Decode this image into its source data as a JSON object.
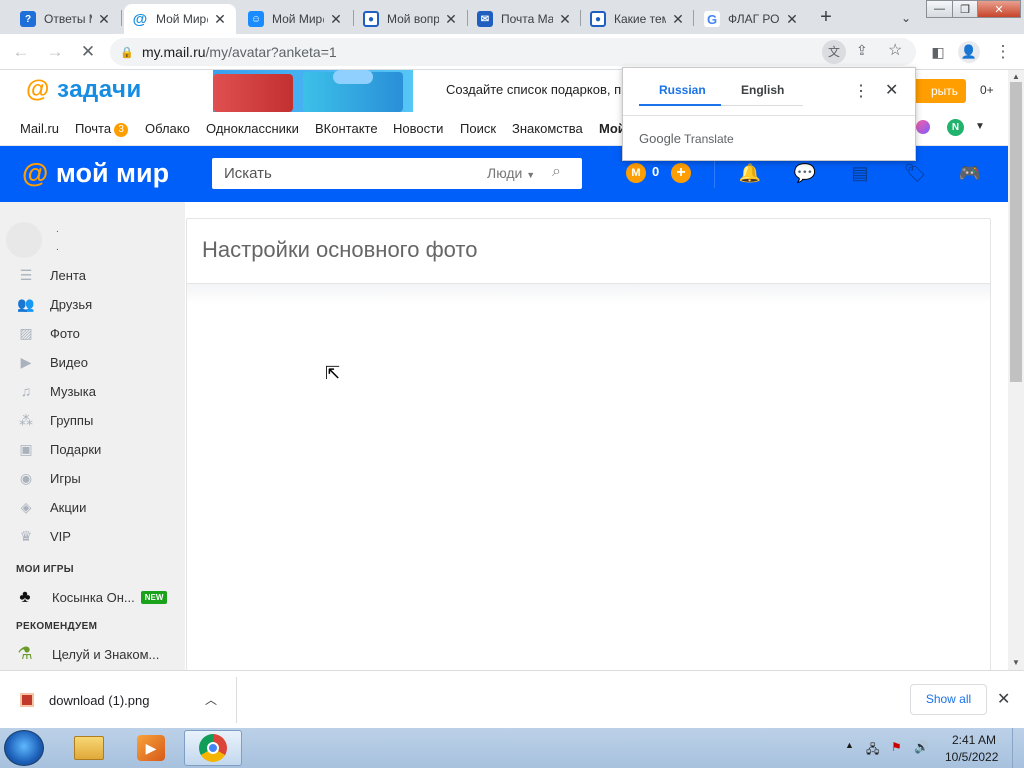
{
  "browser": {
    "tabs": [
      {
        "title": "Ответы Mail.ru",
        "favicon": "answers-icon"
      },
      {
        "title": "Мой Мир@Mail.ru",
        "favicon": "moy-mir-icon",
        "active": true
      },
      {
        "title": "Мой Мир@Mail.ru",
        "favicon": "moy-mir-face-icon"
      },
      {
        "title": "Мой вопрос",
        "favicon": "answers-icon"
      },
      {
        "title": "Почта Mail.ru",
        "favicon": "mail-icon"
      },
      {
        "title": "Какие темы",
        "favicon": "answers-icon"
      },
      {
        "title": "ФЛАГ РОССИИ",
        "favicon": "google-icon"
      }
    ],
    "new_tab": "+",
    "url_host": "my.mail.ru",
    "url_path": "/my/avatar?anketa=1"
  },
  "banner": {
    "brand": "задачи",
    "text": "Создайте список подарков, п",
    "button": "рыть",
    "age": "0+"
  },
  "portal_nav": {
    "items": [
      "Mail.ru",
      "Почта",
      "Облако",
      "Одноклассники",
      "ВКонтакте",
      "Новости",
      "Поиск",
      "Знакомства",
      "Мой"
    ],
    "mail_badge": "3",
    "avatar_letter": "N"
  },
  "header": {
    "logo": "мой мир",
    "search_placeholder": "Искать",
    "search_scope": "Люди",
    "coins": "0"
  },
  "sidebar": {
    "user_name_1": ".",
    "user_name_2": ".",
    "items": [
      {
        "label": "Лента",
        "icon": "feed-icon"
      },
      {
        "label": "Друзья",
        "icon": "friends-icon"
      },
      {
        "label": "Фото",
        "icon": "photo-icon"
      },
      {
        "label": "Видео",
        "icon": "video-icon"
      },
      {
        "label": "Музыка",
        "icon": "music-icon"
      },
      {
        "label": "Группы",
        "icon": "groups-icon"
      },
      {
        "label": "Подарки",
        "icon": "gift-icon"
      },
      {
        "label": "Игры",
        "icon": "gamepad-icon"
      },
      {
        "label": "Акции",
        "icon": "tag-icon"
      },
      {
        "label": "VIP",
        "icon": "crown-icon"
      }
    ],
    "games_heading": "МОИ ИГРЫ",
    "games": [
      {
        "label": "Косынка Он...",
        "badge": "NEW"
      }
    ],
    "recommend_heading": "РЕКОМЕНДУЕМ",
    "recommend": [
      {
        "label": "Целуй и Знаком..."
      }
    ]
  },
  "main": {
    "title": "Настройки основного фото"
  },
  "translate_popup": {
    "source_lang": "Russian",
    "target_lang": "English",
    "brand_google": "Google",
    "brand_translate": "Translate"
  },
  "downloads": {
    "file_name": "download (1).png",
    "show_all": "Show all"
  },
  "taskbar": {
    "time": "2:41 AM",
    "date": "10/5/2022"
  }
}
